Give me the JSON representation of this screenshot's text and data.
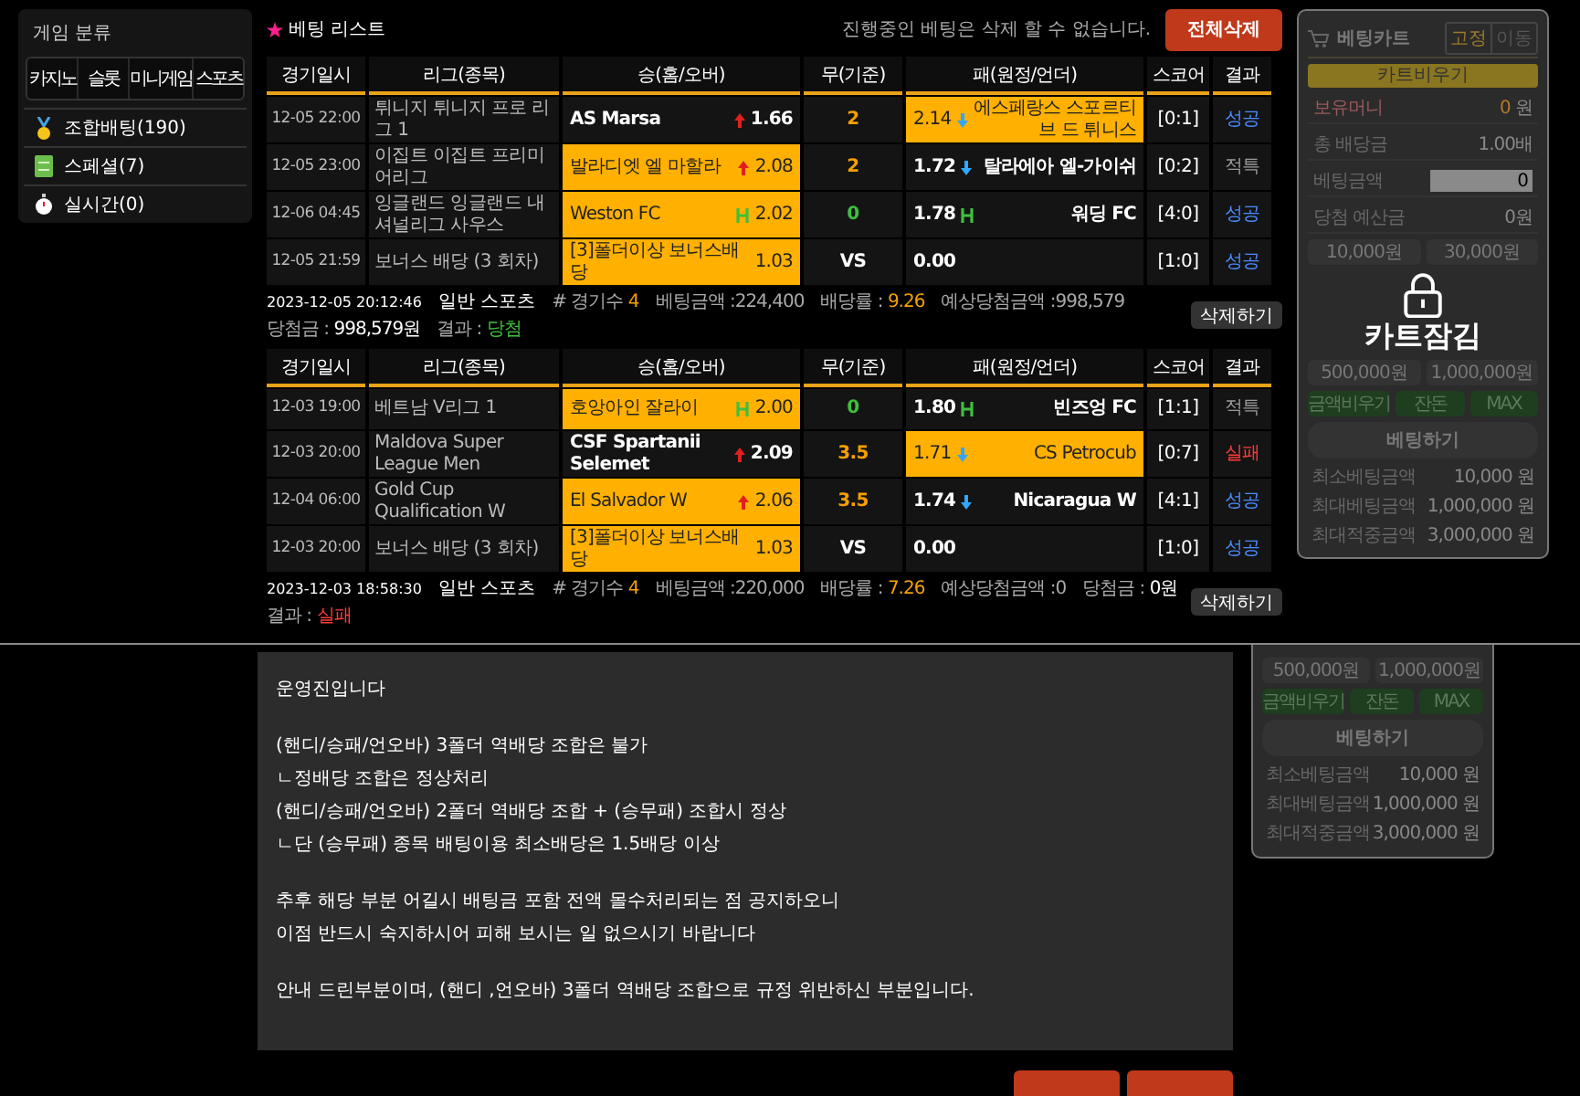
{
  "sidebar": {
    "title": "게임 분류",
    "tabs": [
      {
        "label": "카지노",
        "selected": false
      },
      {
        "label": "슬롯",
        "selected": false
      },
      {
        "label": "미니게임",
        "selected": false
      },
      {
        "label": "스포츠",
        "selected": false
      }
    ],
    "items": [
      {
        "label": "조합배팅(190)",
        "kind": "medal"
      },
      {
        "label": "스페셜(7)",
        "kind": "ticket"
      },
      {
        "label": "실시간(0)",
        "kind": "stopwatch"
      }
    ]
  },
  "bet_list": {
    "title": "베팅 리스트",
    "notice": "진행중인 베팅은 삭제 할 수 없습니다.",
    "delete_all": "전체삭제",
    "slips": [
      {
        "columns": [
          "경기일시",
          "리그(종목)",
          "승(홈/오버)",
          "무(기준)",
          "패(원정/언더)",
          "스코어",
          "결과"
        ],
        "rows": [
          {
            "date": "12-05 22:00",
            "league": "튀니지 튀니지 프로 리그 1",
            "home": {
              "name": "AS Marsa",
              "odds": "1.66",
              "kind": "up",
              "selected": false
            },
            "draw": {
              "text": "2",
              "color": "#f5a000"
            },
            "away": {
              "name": "에스페랑스 스포르티브 드 튀니스",
              "odds": "2.14",
              "kind": "down",
              "selected": true
            },
            "score": "[0:1]",
            "result": {
              "text": "성공",
              "color": "#4a8cff"
            }
          },
          {
            "date": "12-05 23:00",
            "league": "이집트 이집트 프리미어리그",
            "home": {
              "name": "발라디엣 엘 마할라",
              "odds": "2.08",
              "kind": "up",
              "selected": true
            },
            "draw": {
              "text": "2",
              "color": "#f5a000"
            },
            "away": {
              "name": "탈라에아 엘-가이쉬",
              "odds": "1.72",
              "kind": "down",
              "selected": false
            },
            "score": "[0:2]",
            "result": {
              "text": "적특",
              "color": "#9a9a9a"
            }
          },
          {
            "date": "12-06 04:45",
            "league": "잉글랜드 잉글랜드 내셔널리그 사우스",
            "home": {
              "name": "Weston FC",
              "odds": "2.02",
              "kind": "handicap",
              "selected": true
            },
            "draw": {
              "text": "0",
              "color": "#3fbf3f"
            },
            "away": {
              "name": "워딩 FC",
              "odds": "1.78",
              "kind": "handicap",
              "selected": false
            },
            "score": "[4:0]",
            "result": {
              "text": "성공",
              "color": "#4a8cff"
            }
          },
          {
            "date": "12-05 21:59",
            "league": "보너스 배당 (3 회차)",
            "home": {
              "name": "[3]폴더이상 보너스배당",
              "odds": "1.03",
              "selected": true
            },
            "draw": {
              "text": "VS",
              "color": "#ffffff"
            },
            "away": {
              "odds": "0.00",
              "selected": false
            },
            "score": "[1:0]",
            "result": {
              "text": "성공",
              "color": "#4a8cff"
            }
          }
        ],
        "summary": {
          "date": "2023-12-05 20:12:46",
          "type": "일반 스포츠",
          "fields": [
            {
              "label": "# 경기수",
              "value": "4",
              "color": "#f5a000"
            },
            {
              "label": "베팅금액 :224,400"
            },
            {
              "label": "배당률 :",
              "value": "9.26",
              "color": "#f5a000"
            },
            {
              "label": "예상당첨금액 :998,579"
            },
            {
              "label": "당첨금 :",
              "value": "998,579원",
              "color": "#ffffff"
            },
            {
              "label": "결과 :",
              "value": "당첨",
              "color": "#3fbf3f"
            }
          ],
          "delete": "삭제하기"
        }
      },
      {
        "columns": [
          "경기일시",
          "리그(종목)",
          "승(홈/오버)",
          "무(기준)",
          "패(원정/언더)",
          "스코어",
          "결과"
        ],
        "rows": [
          {
            "date": "12-03 19:00",
            "league": "베트남 V리그 1",
            "home": {
              "name": "호앙아인 잘라이",
              "odds": "2.00",
              "kind": "handicap",
              "selected": true
            },
            "draw": {
              "text": "0",
              "color": "#3fbf3f"
            },
            "away": {
              "name": "빈즈엉 FC",
              "odds": "1.80",
              "kind": "handicap",
              "selected": false
            },
            "score": "[1:1]",
            "result": {
              "text": "적특",
              "color": "#9a9a9a"
            }
          },
          {
            "date": "12-03 20:00",
            "league": "Maldova Super League Men",
            "home": {
              "name": "CSF Spartanii Selemet",
              "odds": "2.09",
              "kind": "up",
              "selected": false
            },
            "draw": {
              "text": "3.5",
              "color": "#f5a000"
            },
            "away": {
              "name": "CS Petrocub",
              "odds": "1.71",
              "kind": "down",
              "selected": true
            },
            "score": "[0:7]",
            "result": {
              "text": "실패",
              "color": "#ff3b3b"
            }
          },
          {
            "date": "12-04 06:00",
            "league": "Gold Cup Qualification W",
            "home": {
              "name": "El Salvador W",
              "odds": "2.06",
              "kind": "up",
              "selected": true
            },
            "draw": {
              "text": "3.5",
              "color": "#f5a000"
            },
            "away": {
              "name": "Nicaragua W",
              "odds": "1.74",
              "kind": "down",
              "selected": false
            },
            "score": "[4:1]",
            "result": {
              "text": "성공",
              "color": "#4a8cff"
            }
          },
          {
            "date": "12-03 20:00",
            "league": "보너스 배당 (3 회차)",
            "home": {
              "name": "[3]폴더이상 보너스배당",
              "odds": "1.03",
              "selected": true
            },
            "draw": {
              "text": "VS",
              "color": "#ffffff"
            },
            "away": {
              "odds": "0.00",
              "selected": false
            },
            "score": "[1:0]",
            "result": {
              "text": "성공",
              "color": "#4a8cff"
            }
          }
        ],
        "summary": {
          "date": "2023-12-03 18:58:30",
          "type": "일반 스포츠",
          "fields": [
            {
              "label": "# 경기수",
              "value": "4",
              "color": "#f5a000"
            },
            {
              "label": "베팅금액 :220,000"
            },
            {
              "label": "배당률 :",
              "value": "7.26",
              "color": "#f5a000"
            },
            {
              "label": "예상당첨금액 :0"
            },
            {
              "label": "당첨금 :",
              "value": "0원",
              "color": "#ffffff"
            },
            {
              "label": "결과 :",
              "value": "실패",
              "color": "#ff3b3b"
            }
          ],
          "delete": "삭제하기"
        }
      }
    ]
  },
  "cart": {
    "title": "베팅카트",
    "modes": [
      {
        "label": "고정",
        "selected": true
      },
      {
        "label": "이동",
        "selected": false
      }
    ],
    "clear": "카트비우기",
    "info": [
      {
        "label": "보유머니",
        "value": "0",
        "unit": "원",
        "kind": "money"
      },
      {
        "label": "총 배당금",
        "value": "1.00배",
        "kind": "plain"
      },
      {
        "label": "베팅금액",
        "value": "0",
        "kind": "input"
      },
      {
        "label": "당첨 예산금",
        "value": "0원",
        "kind": "plain"
      }
    ],
    "amounts_top": [
      "10,000원",
      "30,000원"
    ],
    "amounts_bottom": [
      "500,000원",
      "1,000,000원"
    ],
    "actions": [
      "금액비우기",
      "잔돈",
      "MAX"
    ],
    "bet_button": "베팅하기",
    "limits": [
      {
        "label": "최소베팅금액",
        "value": "10,000 원"
      },
      {
        "label": "최대베팅금액",
        "value": "1,000,000 원"
      },
      {
        "label": "최대적중금액",
        "value": "3,000,000 원"
      }
    ],
    "locked": true,
    "lock_text": "카트잠김"
  },
  "notice_panel": {
    "paragraphs": [
      [
        "운영진입니다"
      ],
      [
        "(핸디/승패/언오바) 3폴더 역배당 조합은 불가",
        "ㄴ정배당 조합은 정상처리",
        "(핸디/승패/언오바) 2폴더 역배당 조합 + (승무패) 조합시 정상",
        "ㄴ단 (승무패) 종목 배팅이용 최소배당은 1.5배당 이상"
      ],
      [
        "추후 해당 부분 어길시 배팅금 포함 전액 몰수처리되는 점 공지하오니",
        "이점 반드시 숙지하시어 피해 보시는 일 없으시기 바랍니다"
      ],
      [
        "안내 드린부분이며,  (핸디 ,언오바) 3폴더 역배당 조합으로 규정 위반하신 부분입니다."
      ]
    ]
  },
  "cart_lower": {
    "amounts": [
      "500,000원",
      "1,000,000원"
    ],
    "actions": [
      "금액비우기",
      "잔돈",
      "MAX"
    ],
    "bet_button": "베팅하기",
    "limits": [
      {
        "label": "최소베팅금액",
        "value": "10,000 원"
      },
      {
        "label": "최대베팅금액",
        "value": "1,000,000 원"
      },
      {
        "label": "최대적중금액",
        "value": "3,000,000 원"
      }
    ]
  }
}
